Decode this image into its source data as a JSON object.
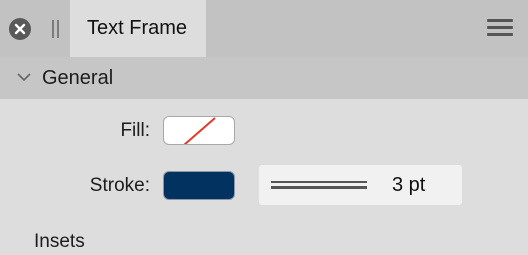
{
  "titlebar": {
    "tab_label": "Text Frame",
    "close_icon": "close-icon",
    "grip_icon": "drag-handle-icon",
    "menu_icon": "hamburger-menu-icon"
  },
  "section": {
    "title": "General",
    "expanded": true,
    "chevron_icon": "chevron-down-icon"
  },
  "fill": {
    "label": "Fill:",
    "value": "none",
    "swatch_color": "#ffffff",
    "none_indicator_color": "#e03a2a"
  },
  "stroke": {
    "label": "Stroke:",
    "swatch_color": "#02325f",
    "width_value": "3 pt"
  },
  "insets": {
    "label": "Insets"
  }
}
